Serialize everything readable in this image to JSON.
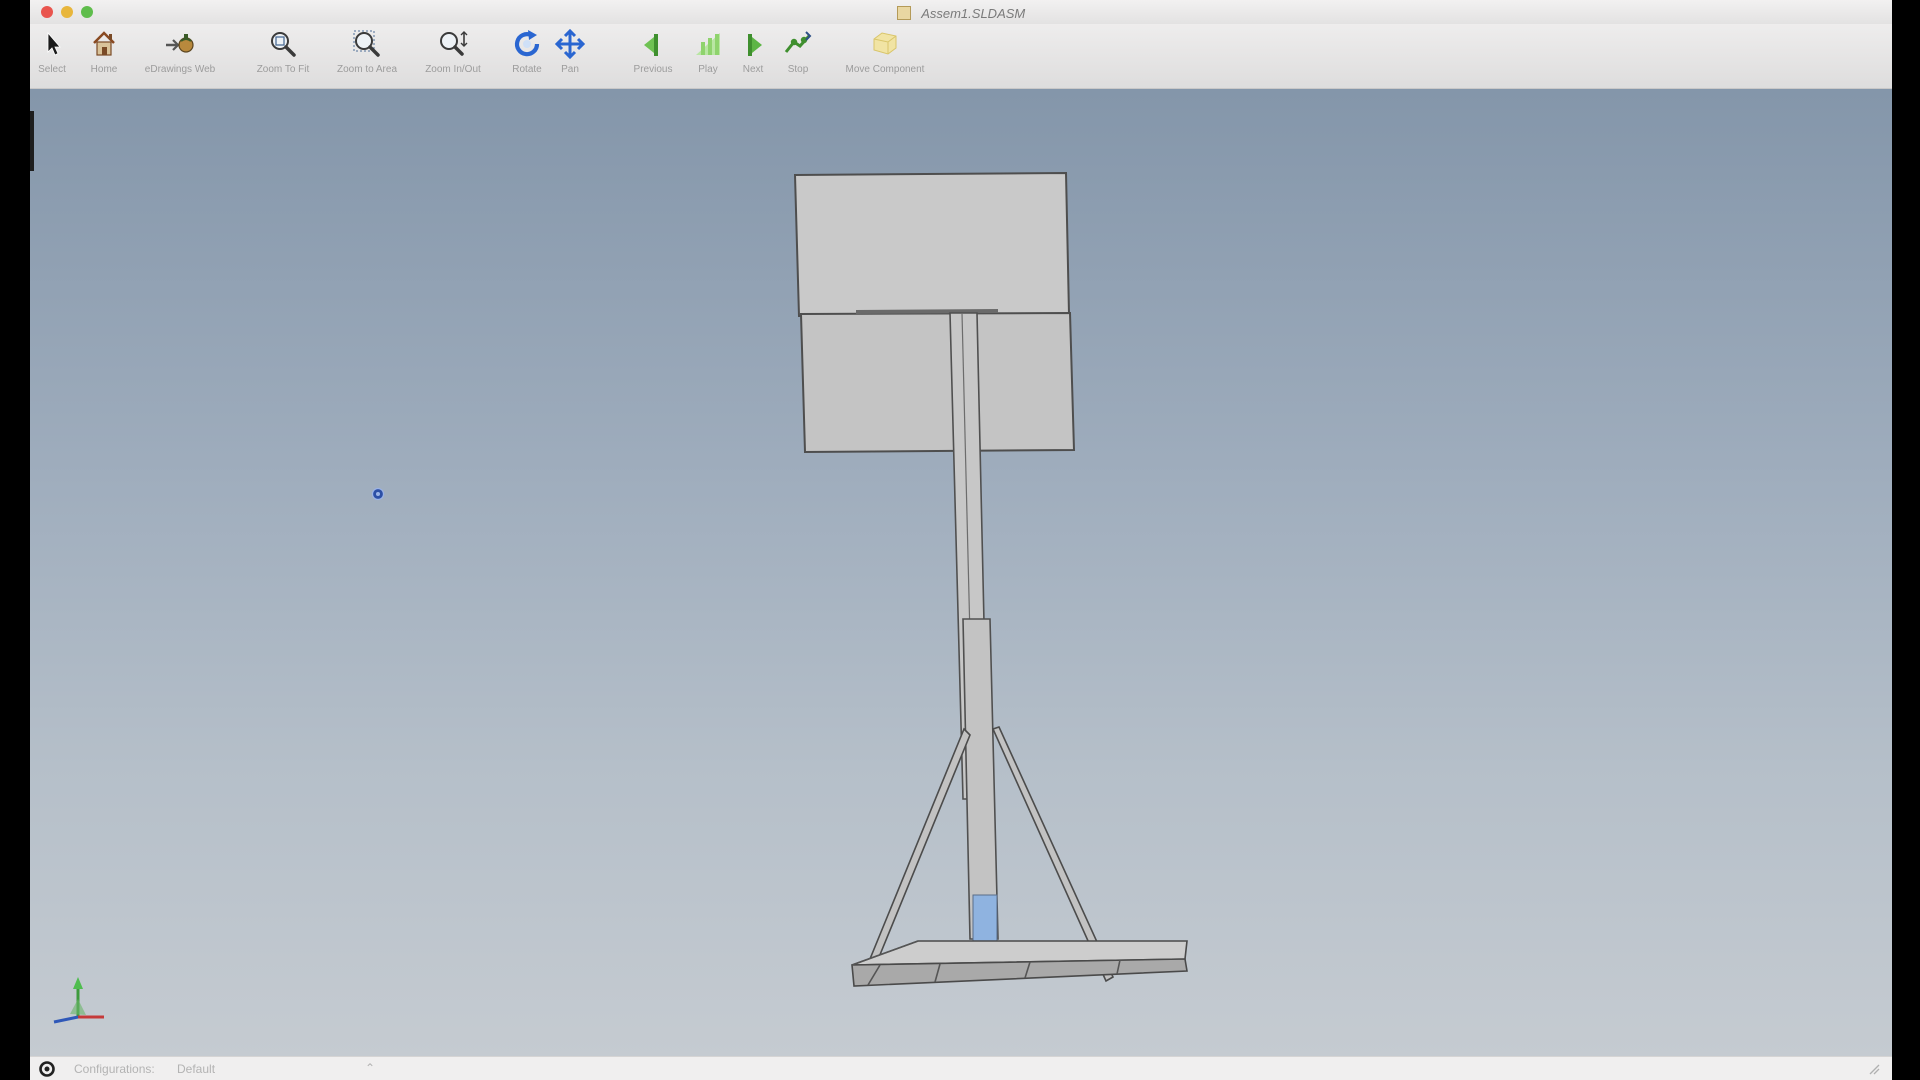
{
  "window": {
    "title": "Assem1.SLDASM"
  },
  "toolbar": {
    "tools": [
      {
        "id": "select",
        "label": "Select",
        "icon": "pointer-arrow-icon"
      },
      {
        "id": "home",
        "label": "Home",
        "icon": "house-icon"
      },
      {
        "id": "edrawings-web",
        "label": "eDrawings Web",
        "icon": "edrawings-web-icon"
      },
      {
        "id": "zoom-to-fit",
        "label": "Zoom To Fit",
        "icon": "zoom-to-fit-icon"
      },
      {
        "id": "zoom-to-area",
        "label": "Zoom to Area",
        "icon": "zoom-to-area-icon"
      },
      {
        "id": "zoom-in-out",
        "label": "Zoom In/Out",
        "icon": "zoom-in-out-icon"
      },
      {
        "id": "rotate",
        "label": "Rotate",
        "icon": "rotate-icon"
      },
      {
        "id": "pan",
        "label": "Pan",
        "icon": "pan-icon"
      },
      {
        "id": "previous",
        "label": "Previous",
        "icon": "previous-icon"
      },
      {
        "id": "play",
        "label": "Play",
        "icon": "play-icon"
      },
      {
        "id": "next",
        "label": "Next",
        "icon": "next-icon"
      },
      {
        "id": "stop",
        "label": "Stop",
        "icon": "stop-icon"
      },
      {
        "id": "move-component",
        "label": "Move Component",
        "icon": "move-component-icon"
      }
    ]
  },
  "status": {
    "config_label": "Configurations:",
    "config_value": "Default",
    "chevron": "⌃"
  },
  "colors": {
    "viewport_top": "#8496aa",
    "viewport_bottom": "#c5cbd1",
    "model_face": "#c9c9c9",
    "model_edge": "#4e4e4e",
    "accent_blue": "#8fb3e0"
  }
}
